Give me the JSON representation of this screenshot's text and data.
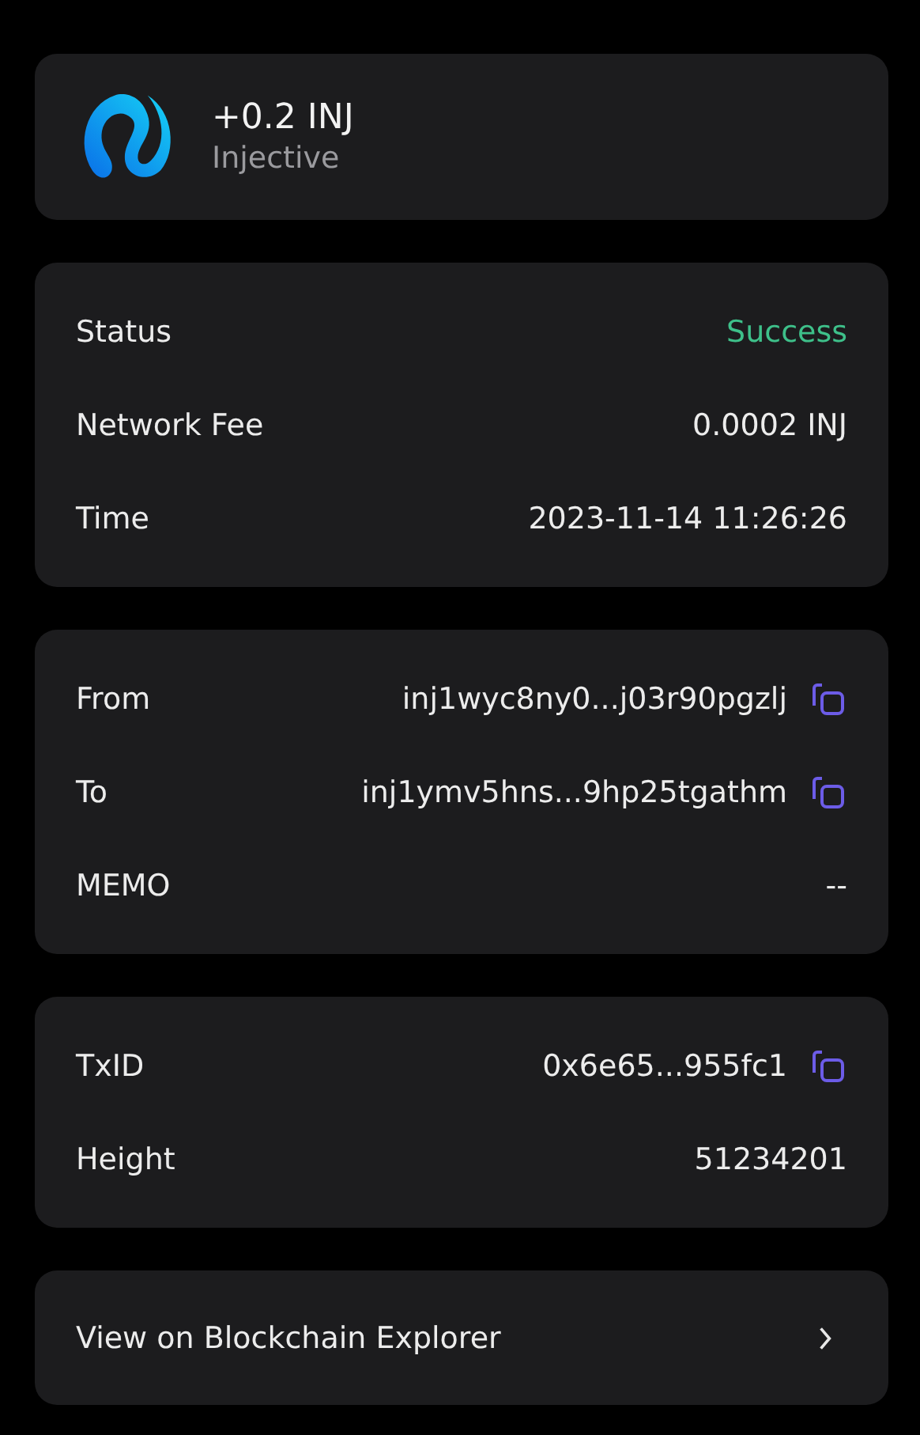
{
  "asset": {
    "amount": "+0.2 INJ",
    "network": "Injective"
  },
  "sections": [
    {
      "rows": [
        {
          "label": "Status",
          "value": "Success",
          "kind": "status",
          "copyable": false
        },
        {
          "label": "Network Fee",
          "value": "0.0002 INJ",
          "kind": "plain",
          "copyable": false
        },
        {
          "label": "Time",
          "value": "2023-11-14 11:26:26",
          "kind": "plain",
          "copyable": false
        }
      ]
    },
    {
      "rows": [
        {
          "label": "From",
          "value": "inj1wyc8ny0...j03r90pgzlj",
          "kind": "plain",
          "copyable": true
        },
        {
          "label": "To",
          "value": "inj1ymv5hns...9hp25tgathm",
          "kind": "plain",
          "copyable": true
        },
        {
          "label": "MEMO",
          "value": "--",
          "kind": "plain",
          "copyable": false
        }
      ]
    },
    {
      "rows": [
        {
          "label": "TxID",
          "value": "0x6e65...955fc1",
          "kind": "plain",
          "copyable": true
        },
        {
          "label": "Height",
          "value": "51234201",
          "kind": "plain",
          "copyable": false
        }
      ]
    }
  ],
  "explorer_link": {
    "label": "View on Blockchain Explorer"
  }
}
